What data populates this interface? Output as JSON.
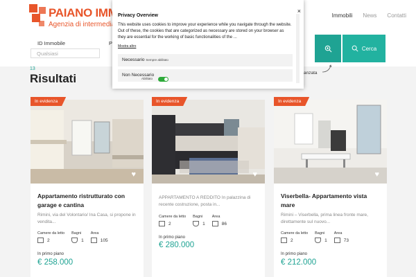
{
  "header": {
    "logo_line1": "PAIANO IMMOBILIARE",
    "logo_line2": "Agenzia di intermediazione",
    "nav": [
      "Immobili",
      "News",
      "Contatti"
    ]
  },
  "search": {
    "id_label": "ID Immobile",
    "id_placeholder": "Qualsiasi",
    "partial_label": "P",
    "cerca_label": "Cerca",
    "advanced_partial": "anzata"
  },
  "results": {
    "count": "13",
    "title": "Risultati"
  },
  "cookie": {
    "title": "Privacy Overview",
    "close": "×",
    "text": "This website uses cookies to improve your experience while you navigate through the website. Out of these, the cookies that are categorized as necessary are stored on your browser as they are essential for the working of basic functionalities of the ...",
    "more": "Mostra altro",
    "necessario": "Necessario",
    "sempre": "Sempre abilitato",
    "non_necessario": "Non Necessario",
    "abilitato": "Abilitato"
  },
  "labels": {
    "badge": "In evidenza",
    "camere": "Camere da letto",
    "bagni": "Bagni",
    "area": "Area",
    "piano": "In primo piano"
  },
  "cards": [
    {
      "title": "Appartamento ristrutturato con garage e cantina",
      "desc": "Rimini, via del Volontario/ Ina Casa, si propone in vendita...",
      "camere": "2",
      "bagni": "1",
      "area": "105",
      "price": "€ 258.000"
    },
    {
      "title": "",
      "desc": "APPARTAMENTO A REDDITO In palazzina di recente costruzione, posta in...",
      "camere": "2",
      "bagni": "1",
      "area": "86",
      "price": "€ 280.000"
    },
    {
      "title": "Viserbella- Appartamento vista mare",
      "desc": "Rimini – Viserbella, prima linea fronte mare, direttamente sul nuovo...",
      "camere": "2",
      "bagni": "1",
      "area": "73",
      "price": "€ 212.000"
    }
  ]
}
